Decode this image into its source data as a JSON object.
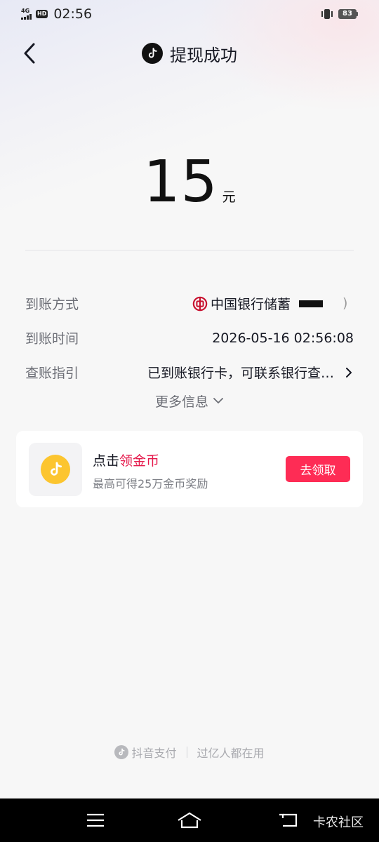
{
  "status_bar": {
    "network": "4G",
    "hd": "HD",
    "time": "02:56",
    "battery": "83"
  },
  "header": {
    "title": "提现成功"
  },
  "amount": {
    "value": "15",
    "unit": "元"
  },
  "details": [
    {
      "label": "到账方式",
      "value": "中国银行储蓄"
    },
    {
      "label": "到账时间",
      "value": "2026-05-16 02:56:08"
    },
    {
      "label": "查账指引",
      "value": "已到账银行卡，可联系银行查…"
    }
  ],
  "more_info": "更多信息",
  "task_card": {
    "title_prefix": "点击",
    "title_highlight": "领金币",
    "subtitle": "最高可得25万金币奖励",
    "button": "去领取"
  },
  "footer": {
    "brand": "抖音支付",
    "slogan": "过亿人都在用"
  },
  "watermark": "卡农社区",
  "colors": {
    "accent": "#fe2c55",
    "highlight": "#e5194b",
    "coin": "#fcc52f",
    "boc_red": "#c8102e"
  }
}
